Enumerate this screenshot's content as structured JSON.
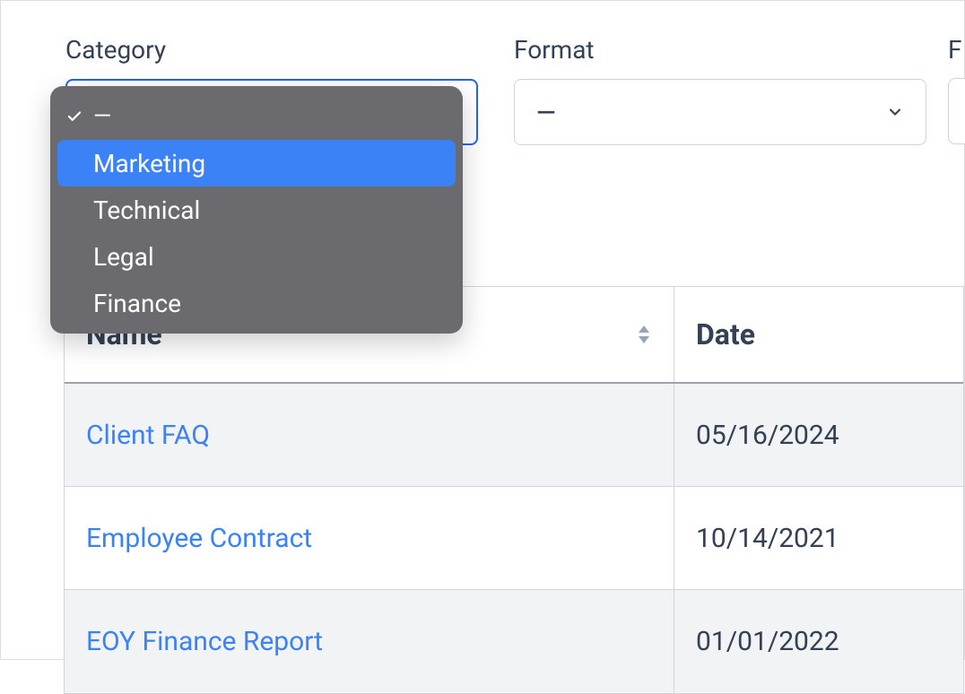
{
  "filters": {
    "category": {
      "label": "Category",
      "selected": "—",
      "options": [
        {
          "label": "—",
          "checked": true,
          "highlighted": false
        },
        {
          "label": "Marketing",
          "checked": false,
          "highlighted": true
        },
        {
          "label": "Technical",
          "checked": false,
          "highlighted": false
        },
        {
          "label": "Legal",
          "checked": false,
          "highlighted": false
        },
        {
          "label": "Finance",
          "checked": false,
          "highlighted": false
        }
      ]
    },
    "format": {
      "label": "Format",
      "selected": "—"
    },
    "partial": {
      "label": "F"
    }
  },
  "table": {
    "headers": {
      "name": "Name",
      "date": "Date"
    },
    "rows": [
      {
        "name": "Client FAQ",
        "date": "05/16/2024"
      },
      {
        "name": "Employee Contract",
        "date": "10/14/2021"
      },
      {
        "name": "EOY Finance Report",
        "date": "01/01/2022"
      }
    ]
  }
}
